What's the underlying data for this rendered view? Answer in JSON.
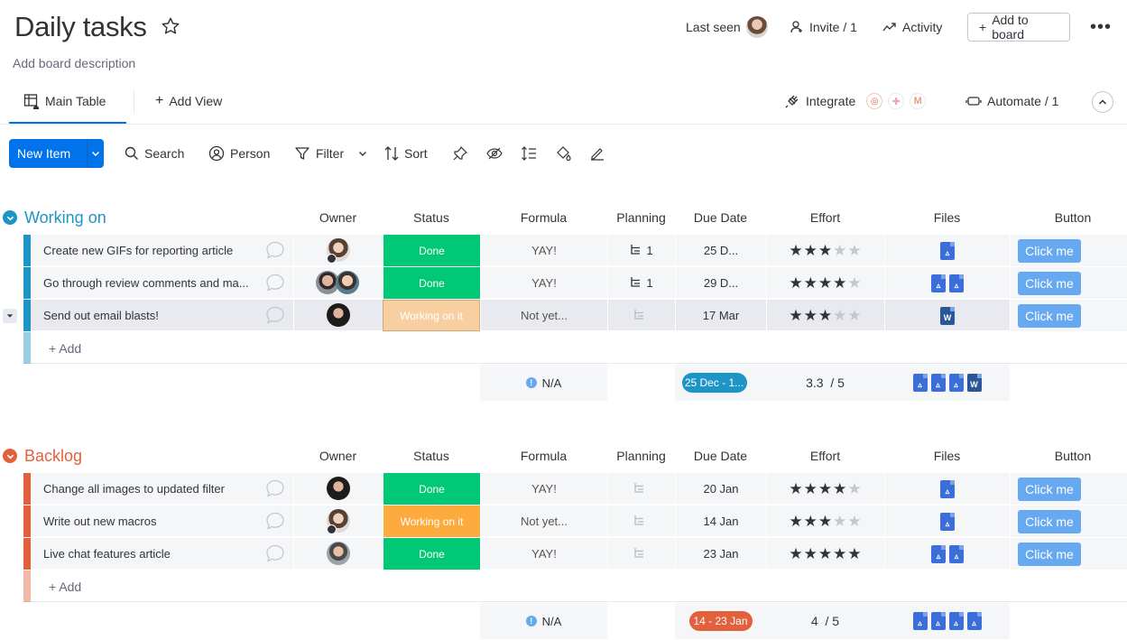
{
  "header": {
    "title": "Daily tasks",
    "description": "Add board description",
    "last_seen": "Last seen",
    "invite": "Invite / 1",
    "activity": "Activity",
    "add_to_board": "Add to board"
  },
  "tabs": {
    "main_table": "Main Table",
    "add_view": "Add View",
    "integrate": "Integrate",
    "automate": "Automate / 1"
  },
  "toolbar": {
    "new_item": "New Item",
    "search": "Search",
    "person": "Person",
    "filter": "Filter",
    "sort": "Sort"
  },
  "columns": [
    "Owner",
    "Status",
    "Formula",
    "Planning",
    "Due Date",
    "Effort",
    "Files",
    "Button"
  ],
  "groups": [
    {
      "title": "Working on",
      "color": "#1e94c7",
      "rows": [
        {
          "name": "Create new GIFs for reporting article",
          "status": "Done",
          "status_color": "#00c875",
          "formula": "YAY!",
          "planning": "1",
          "due": "25 D...",
          "effort": 3,
          "files": [
            "drive"
          ],
          "button": "Click me"
        },
        {
          "name": "Go through review comments and ma...",
          "status": "Done",
          "status_color": "#00c875",
          "formula": "YAY!",
          "planning": "1",
          "due": "29 D...",
          "effort": 4,
          "files": [
            "drive",
            "drive"
          ],
          "button": "Click me"
        },
        {
          "name": "Send out email blasts!",
          "status": "Working on it",
          "status_color": "#f8cfa0",
          "formula": "Not yet...",
          "planning": "",
          "due": "17 Mar",
          "effort": 3,
          "files": [
            "word"
          ],
          "button": "Click me"
        }
      ],
      "add_label": "+ Add",
      "summary": {
        "formula": "N/A",
        "due": "25 Dec - 1...",
        "due_color": "#1e94c7",
        "effort": "3.3  / 5",
        "files": [
          "drive",
          "drive",
          "drive",
          "word"
        ]
      }
    },
    {
      "title": "Backlog",
      "color": "#e2603c",
      "rows": [
        {
          "name": "Change all images to updated filter",
          "status": "Done",
          "status_color": "#00c875",
          "formula": "YAY!",
          "planning": "",
          "due": "20 Jan",
          "effort": 4,
          "files": [
            "drive"
          ],
          "button": "Click me"
        },
        {
          "name": "Write out new macros",
          "status": "Working on it",
          "status_color": "#fdab3d",
          "formula": "Not yet...",
          "planning": "",
          "due": "14 Jan",
          "effort": 3,
          "files": [
            "drive"
          ],
          "button": "Click me"
        },
        {
          "name": "Live chat features article",
          "status": "Done",
          "status_color": "#00c875",
          "formula": "YAY!",
          "planning": "",
          "due": "23 Jan",
          "effort": 5,
          "files": [
            "drive",
            "drive"
          ],
          "button": "Click me"
        }
      ],
      "add_label": "+ Add",
      "summary": {
        "formula": "N/A",
        "due": "14 - 23 Jan",
        "due_color": "#e2603c",
        "effort": "4  / 5",
        "files": [
          "drive",
          "drive",
          "drive",
          "drive"
        ]
      }
    }
  ]
}
